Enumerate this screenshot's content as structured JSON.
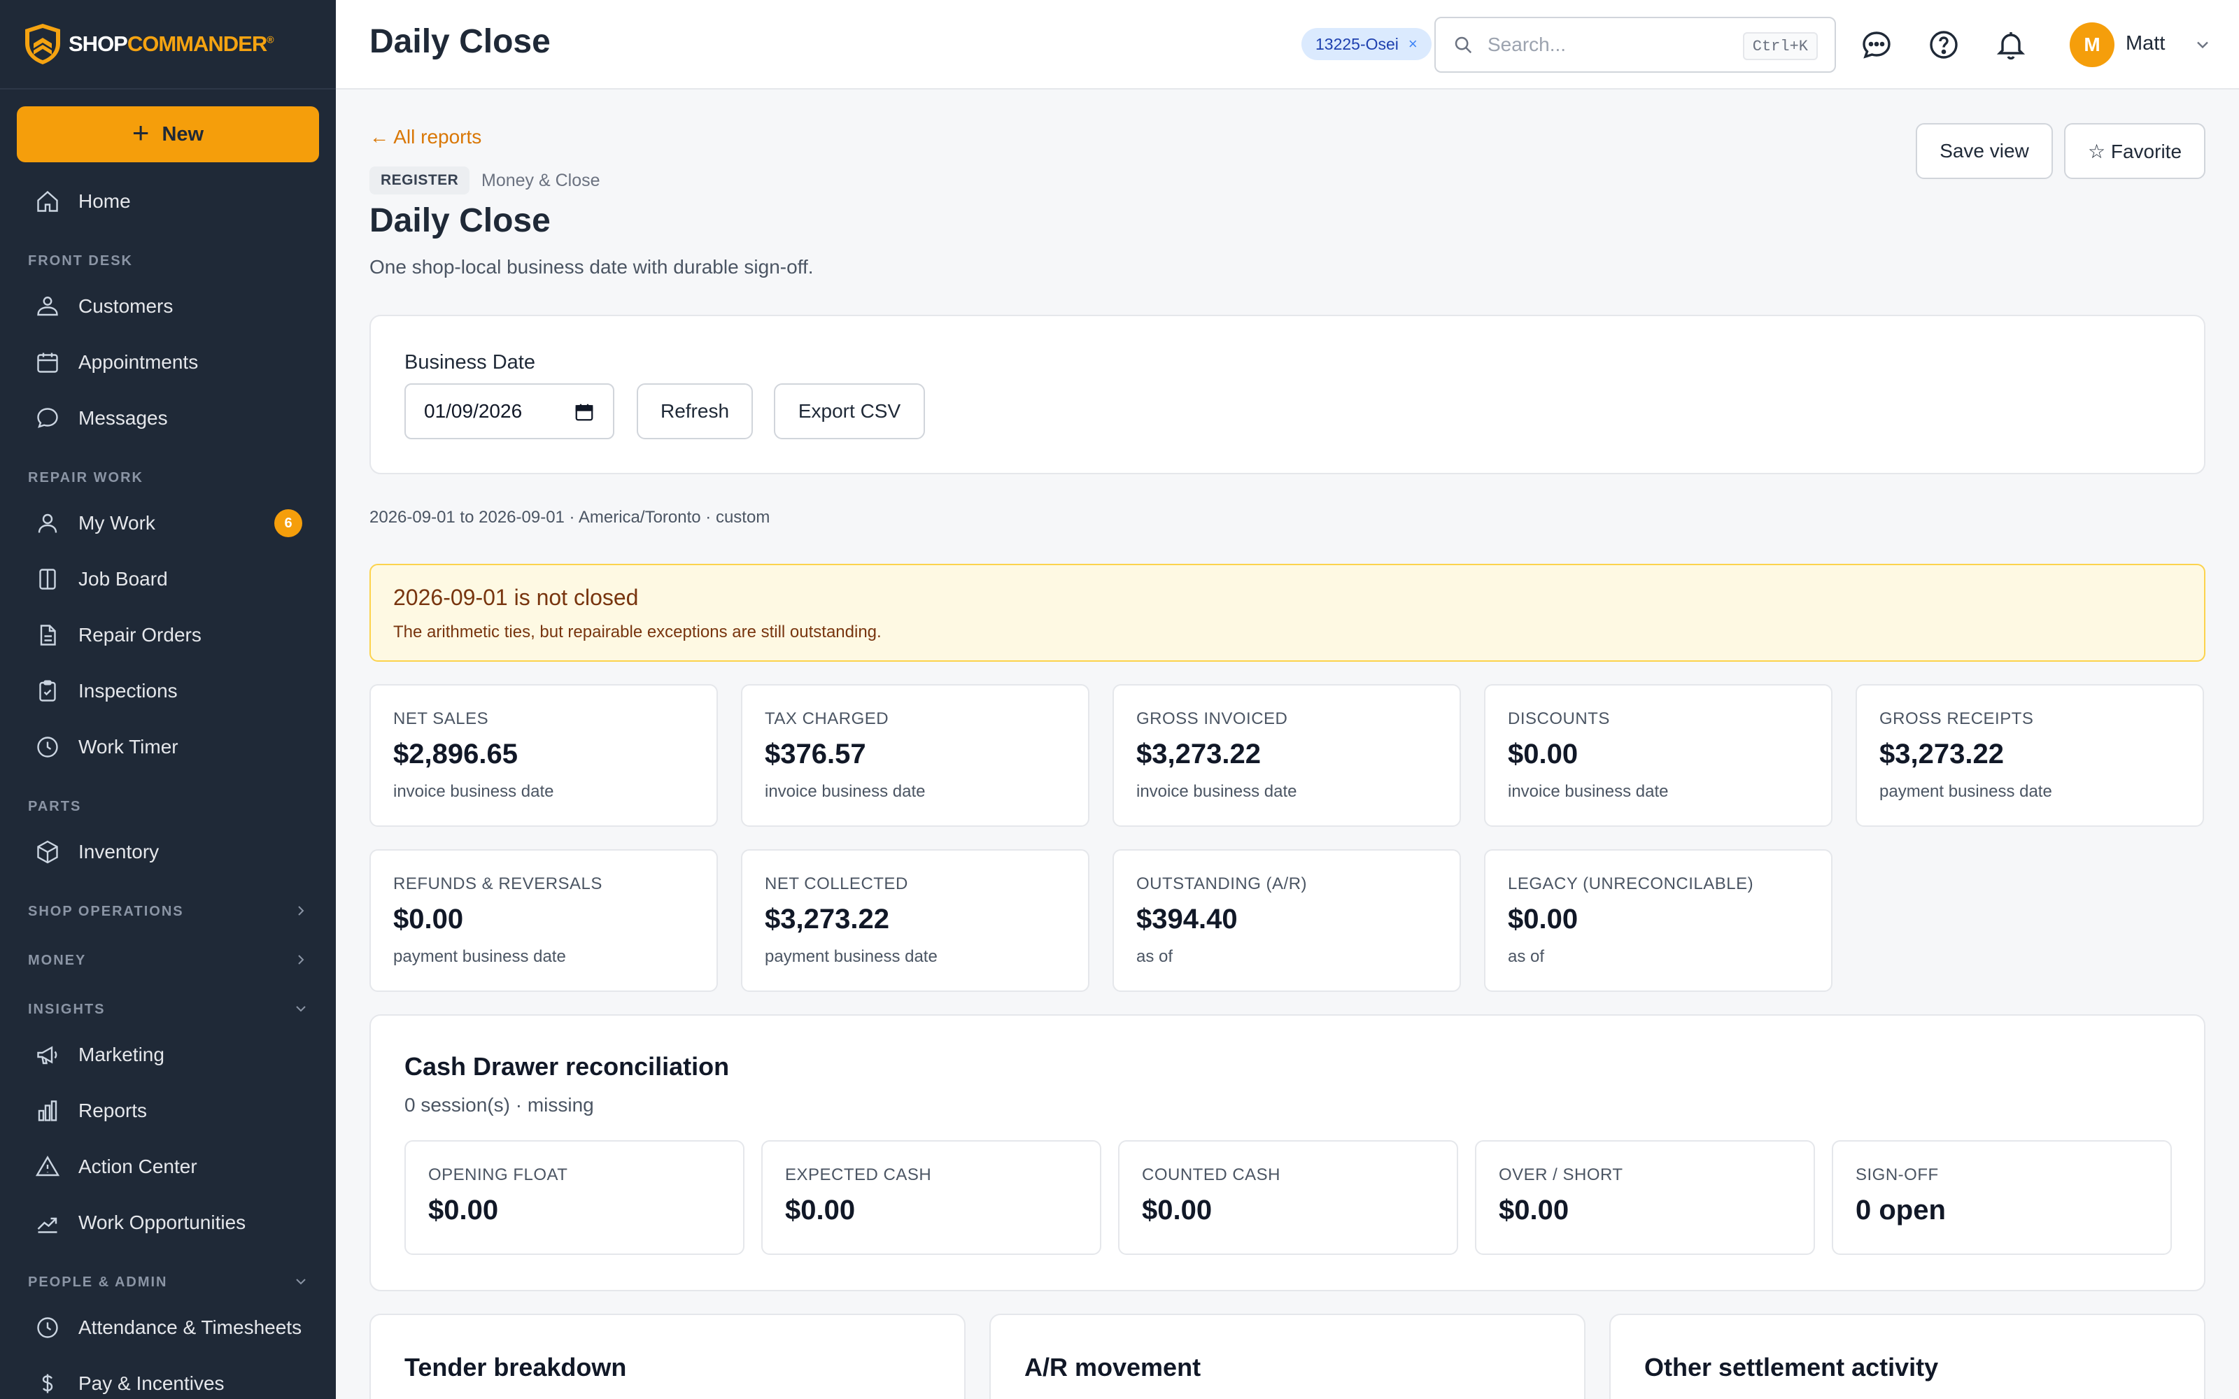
{
  "brand": {
    "part1": "SHOP",
    "part2": "COMMANDER",
    "mark": "®"
  },
  "sidebar": {
    "new_label": "New",
    "home": "Home",
    "sections": {
      "front_desk": "FRONT DESK",
      "repair_work": "REPAIR WORK",
      "parts": "PARTS",
      "shop_operations": "SHOP OPERATIONS",
      "money": "MONEY",
      "insights": "INSIGHTS",
      "people_admin": "PEOPLE & ADMIN"
    },
    "items": {
      "customers": "Customers",
      "appointments": "Appointments",
      "messages": "Messages",
      "my_work": "My Work",
      "my_work_badge": "6",
      "job_board": "Job Board",
      "repair_orders": "Repair Orders",
      "inspections": "Inspections",
      "work_timer": "Work Timer",
      "inventory": "Inventory",
      "marketing": "Marketing",
      "reports": "Reports",
      "action_center": "Action Center",
      "work_opportunities": "Work Opportunities",
      "attendance": "Attendance & Timesheets",
      "pay": "Pay & Incentives"
    }
  },
  "header": {
    "title": "Daily Close",
    "chip": "13225-Osei",
    "chip_close": "×",
    "search_placeholder": "Search...",
    "search_shortcut": "Ctrl+K",
    "user_initial": "M",
    "user_name": "Matt"
  },
  "page": {
    "back_link": "← All reports",
    "save_view": "Save view",
    "favorite": "☆ Favorite",
    "tag": "REGISTER",
    "category": "Money & Close",
    "title": "Daily Close",
    "subtitle": "One shop-local business date with durable sign-off."
  },
  "filters": {
    "business_date_label": "Business Date",
    "business_date_value": "01/09/2026",
    "refresh": "Refresh",
    "export_csv": "Export CSV"
  },
  "range_line": "2026-09-01 to 2026-09-01 · America/Toronto · custom",
  "alert": {
    "title": "2026-09-01 is not closed",
    "body": "The arithmetic ties, but repairable exceptions are still outstanding."
  },
  "metrics": [
    {
      "label": "NET SALES",
      "value": "$2,896.65",
      "sub": "invoice business date"
    },
    {
      "label": "TAX CHARGED",
      "value": "$376.57",
      "sub": "invoice business date"
    },
    {
      "label": "GROSS INVOICED",
      "value": "$3,273.22",
      "sub": "invoice business date"
    },
    {
      "label": "DISCOUNTS",
      "value": "$0.00",
      "sub": "invoice business date"
    },
    {
      "label": "GROSS RECEIPTS",
      "value": "$3,273.22",
      "sub": "payment business date"
    },
    {
      "label": "REFUNDS & REVERSALS",
      "value": "$0.00",
      "sub": "payment business date"
    },
    {
      "label": "NET COLLECTED",
      "value": "$3,273.22",
      "sub": "payment business date"
    },
    {
      "label": "OUTSTANDING (A/R)",
      "value": "$394.40",
      "sub": "as of"
    },
    {
      "label": "LEGACY (UNRECONCILABLE)",
      "value": "$0.00",
      "sub": "as of"
    }
  ],
  "cash_drawer": {
    "title": "Cash Drawer reconciliation",
    "subtitle": "0 session(s) · missing",
    "boxes": [
      {
        "label": "OPENING FLOAT",
        "value": "$0.00"
      },
      {
        "label": "EXPECTED CASH",
        "value": "$0.00"
      },
      {
        "label": "COUNTED CASH",
        "value": "$0.00"
      },
      {
        "label": "OVER / SHORT",
        "value": "$0.00"
      },
      {
        "label": "SIGN-OFF",
        "value": "0 open"
      }
    ]
  },
  "bottom_cards": {
    "tender": "Tender breakdown",
    "ar": "A/R movement",
    "other": "Other settlement activity"
  },
  "colors": {
    "accent": "#f59e0b",
    "sidebar_bg": "#1f2937",
    "link": "#d97706",
    "warn_bg": "#fef9e3"
  }
}
